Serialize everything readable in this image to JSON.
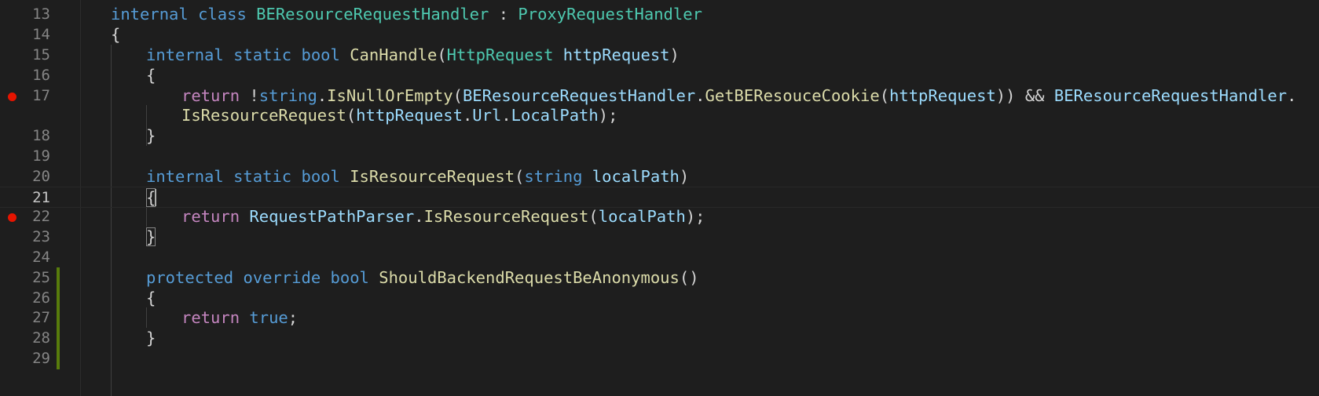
{
  "editor": {
    "lines": [
      {
        "number": "13",
        "parts": [
          {
            "t": "internal",
            "c": "kw"
          },
          {
            "t": " ",
            "c": "plain"
          },
          {
            "t": "class",
            "c": "kw"
          },
          {
            "t": " ",
            "c": "plain"
          },
          {
            "t": "BEResourceRequestHandler",
            "c": "type"
          },
          {
            "t": " : ",
            "c": "plain"
          },
          {
            "t": "ProxyRequestHandler",
            "c": "type"
          }
        ]
      },
      {
        "number": "14",
        "parts": [
          {
            "t": "{",
            "c": "plain"
          }
        ]
      },
      {
        "number": "15",
        "parts": [
          {
            "t": "internal",
            "c": "kw"
          },
          {
            "t": " ",
            "c": "plain"
          },
          {
            "t": "static",
            "c": "kw"
          },
          {
            "t": " ",
            "c": "plain"
          },
          {
            "t": "bool",
            "c": "kw"
          },
          {
            "t": " ",
            "c": "plain"
          },
          {
            "t": "CanHandle",
            "c": "fn"
          },
          {
            "t": "(",
            "c": "plain"
          },
          {
            "t": "HttpRequest",
            "c": "type"
          },
          {
            "t": " ",
            "c": "plain"
          },
          {
            "t": "httpRequest",
            "c": "var"
          },
          {
            "t": ")",
            "c": "plain"
          }
        ]
      },
      {
        "number": "16",
        "parts": [
          {
            "t": "{",
            "c": "plain"
          }
        ]
      },
      {
        "number": "17",
        "parts": [
          {
            "t": "return",
            "c": "ctrl"
          },
          {
            "t": " !",
            "c": "plain"
          },
          {
            "t": "string",
            "c": "kw"
          },
          {
            "t": ".",
            "c": "plain"
          },
          {
            "t": "IsNullOrEmpty",
            "c": "fn"
          },
          {
            "t": "(",
            "c": "plain"
          },
          {
            "t": "BEResourceRequestHandler",
            "c": "var"
          },
          {
            "t": ".",
            "c": "plain"
          },
          {
            "t": "GetBEResouceCookie",
            "c": "fn"
          },
          {
            "t": "(",
            "c": "plain"
          },
          {
            "t": "httpRequest",
            "c": "var"
          },
          {
            "t": ")) && ",
            "c": "plain"
          },
          {
            "t": "BEResourceRequestHandler",
            "c": "var"
          },
          {
            "t": ".",
            "c": "plain"
          }
        ]
      },
      {
        "number": "",
        "parts": [
          {
            "t": "IsResourceRequest",
            "c": "fn"
          },
          {
            "t": "(",
            "c": "plain"
          },
          {
            "t": "httpRequest",
            "c": "var"
          },
          {
            "t": ".",
            "c": "plain"
          },
          {
            "t": "Url",
            "c": "var"
          },
          {
            "t": ".",
            "c": "plain"
          },
          {
            "t": "LocalPath",
            "c": "var"
          },
          {
            "t": ");",
            "c": "plain"
          }
        ]
      },
      {
        "number": "18",
        "parts": [
          {
            "t": "}",
            "c": "plain"
          }
        ]
      },
      {
        "number": "19",
        "parts": []
      },
      {
        "number": "20",
        "parts": [
          {
            "t": "internal",
            "c": "kw"
          },
          {
            "t": " ",
            "c": "plain"
          },
          {
            "t": "static",
            "c": "kw"
          },
          {
            "t": " ",
            "c": "plain"
          },
          {
            "t": "bool",
            "c": "kw"
          },
          {
            "t": " ",
            "c": "plain"
          },
          {
            "t": "IsResourceRequest",
            "c": "fn"
          },
          {
            "t": "(",
            "c": "plain"
          },
          {
            "t": "string",
            "c": "kw"
          },
          {
            "t": " ",
            "c": "plain"
          },
          {
            "t": "localPath",
            "c": "var"
          },
          {
            "t": ")",
            "c": "plain"
          }
        ]
      },
      {
        "number": "21",
        "parts": [
          {
            "t": "{",
            "c": "plain"
          }
        ]
      },
      {
        "number": "22",
        "parts": [
          {
            "t": "return",
            "c": "ctrl"
          },
          {
            "t": " ",
            "c": "plain"
          },
          {
            "t": "RequestPathParser",
            "c": "var"
          },
          {
            "t": ".",
            "c": "plain"
          },
          {
            "t": "IsResourceRequest",
            "c": "fn"
          },
          {
            "t": "(",
            "c": "plain"
          },
          {
            "t": "localPath",
            "c": "var"
          },
          {
            "t": ");",
            "c": "plain"
          }
        ]
      },
      {
        "number": "23",
        "parts": [
          {
            "t": "}",
            "c": "plain"
          }
        ]
      },
      {
        "number": "24",
        "parts": []
      },
      {
        "number": "25",
        "parts": [
          {
            "t": "protected",
            "c": "kw"
          },
          {
            "t": " ",
            "c": "plain"
          },
          {
            "t": "override",
            "c": "kw"
          },
          {
            "t": " ",
            "c": "plain"
          },
          {
            "t": "bool",
            "c": "kw"
          },
          {
            "t": " ",
            "c": "plain"
          },
          {
            "t": "ShouldBackendRequestBeAnonymous",
            "c": "fn"
          },
          {
            "t": "()",
            "c": "plain"
          }
        ]
      },
      {
        "number": "26",
        "parts": [
          {
            "t": "{",
            "c": "plain"
          }
        ]
      },
      {
        "number": "27",
        "parts": [
          {
            "t": "return",
            "c": "ctrl"
          },
          {
            "t": " ",
            "c": "plain"
          },
          {
            "t": "true",
            "c": "kw"
          },
          {
            "t": ";",
            "c": "plain"
          }
        ]
      },
      {
        "number": "28",
        "parts": [
          {
            "t": "}",
            "c": "plain"
          }
        ]
      },
      {
        "number": "29",
        "parts": []
      }
    ],
    "breakpoint_lines": [
      "17",
      "22"
    ],
    "modified_lines": [
      "25",
      "26",
      "27",
      "28",
      "29"
    ],
    "active_line": "21",
    "colors": {
      "background": "#1e1e1e",
      "keyword": "#569cd6",
      "control": "#c586c0",
      "type": "#4ec9b0",
      "function": "#dcdcaa",
      "variable": "#9cdcfe",
      "breakpoint": "#e51400",
      "modified_bar": "#587c0c"
    }
  }
}
